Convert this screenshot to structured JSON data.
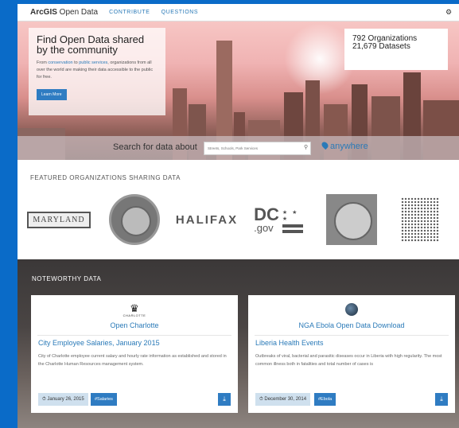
{
  "nav": {
    "logo_prefix": "ArcGIS",
    "logo_suffix": " Open Data",
    "links": [
      "CONTRIBUTE",
      "QUESTIONS"
    ],
    "right_icon": "gear-icon"
  },
  "hero": {
    "title": "Find Open Data shared by the community",
    "text_prefix": "From ",
    "text_link1": "conservation",
    "text_mid": " to ",
    "text_link2": "public services",
    "text_suffix": ", organizations from all over the world are making their data accessible to the public for free.",
    "learn_more": "Learn More",
    "stats": [
      "792 Organizations",
      "21,679 Datasets"
    ],
    "search_label": "Search for data about",
    "search_placeholder": "Streets, Schools, Park Services",
    "anywhere": "anywhere"
  },
  "featured": {
    "title": "FEATURED ORGANIZATIONS SHARING DATA",
    "orgs": {
      "maryland": "MARYLAND",
      "halifax": "HALIFAX",
      "dc_main": "DC",
      "dc_sub": ".gov",
      "dc_stars": "★ ★ ★"
    }
  },
  "noteworthy": {
    "title": "NOTEWORTHY DATA",
    "cards": [
      {
        "logo_icon": "crown-icon",
        "logo_text": "CHARLOTTE",
        "org": "Open Charlotte",
        "title": "City Employee Salaries, January 2015",
        "description": "City of Charlotte employee current salary and hourly rate information as established and stored in the Charlotte Human Resources management system.",
        "date": "January 26, 2015",
        "tag": "#Salaries"
      },
      {
        "logo_icon": "globe-icon",
        "org": "NGA Ebola Open Data Download",
        "title": "Liberia Health Events",
        "description": "Outbreaks of viral, bacterial and parasitic diseases occur in Liberia with high regularity. The most common illness both in fatalities and total number of cases is",
        "date": "December 30, 2014",
        "tag": "#Ebola"
      }
    ]
  }
}
